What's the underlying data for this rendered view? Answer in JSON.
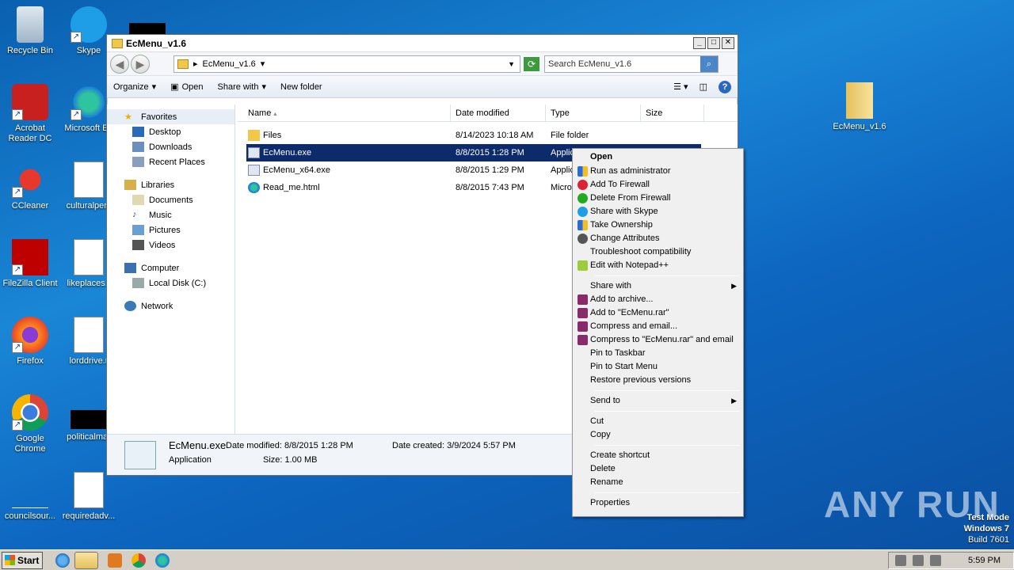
{
  "desktop": {
    "icons_left": [
      "Recycle Bin",
      "Acrobat Reader DC",
      "CCleaner",
      "FileZilla Client",
      "Firefox",
      "Google Chrome",
      "councilsour..."
    ],
    "icons_right": [
      "Skype",
      "Microsoft Ed",
      "culturalpers",
      "likeplaces.r",
      "lorddrive.r",
      "politicalmar",
      "requiredadv..."
    ],
    "folder_icon": "EcMenu_v1.6"
  },
  "window": {
    "title": "EcMenu_v1.6",
    "address": "EcMenu_v1.6",
    "search_placeholder": "Search EcMenu_v1.6",
    "toolbar": {
      "organize": "Organize",
      "open": "Open",
      "share_with": "Share with",
      "new_folder": "New folder"
    },
    "nav": {
      "favorites": "Favorites",
      "desktop": "Desktop",
      "downloads": "Downloads",
      "recent": "Recent Places",
      "libraries": "Libraries",
      "documents": "Documents",
      "music": "Music",
      "pictures": "Pictures",
      "videos": "Videos",
      "computer": "Computer",
      "local_disk": "Local Disk (C:)",
      "network": "Network"
    },
    "columns": {
      "name": "Name",
      "date": "Date modified",
      "type": "Type",
      "size": "Size"
    },
    "files": [
      {
        "name": "Files",
        "date": "8/14/2023 10:18 AM",
        "type": "File folder"
      },
      {
        "name": "EcMenu.exe",
        "date": "8/8/2015 1:28 PM",
        "type": "Applic"
      },
      {
        "name": "EcMenu_x64.exe",
        "date": "8/8/2015 1:29 PM",
        "type": "Applic"
      },
      {
        "name": "Read_me.html",
        "date": "8/8/2015 7:43 PM",
        "type": "Micros"
      }
    ],
    "details": {
      "filename": "EcMenu.exe",
      "type": "Application",
      "modified_label": "Date modified: 8/8/2015 1:28 PM",
      "created_label": "Date created: 3/9/2024 5:57 PM",
      "size_label": "Size: 1.00 MB"
    }
  },
  "context_menu": {
    "group1": [
      "Open",
      "Run as administrator",
      "Add To Firewall",
      "Delete From Firewall",
      "Share with Skype",
      "Take Ownership",
      "Change Attributes",
      "Troubleshoot compatibility",
      "Edit with Notepad++"
    ],
    "group2": [
      "Share with",
      "Add to archive...",
      "Add to \"EcMenu.rar\"",
      "Compress and email...",
      "Compress to \"EcMenu.rar\" and email",
      "Pin to Taskbar",
      "Pin to Start Menu",
      "Restore previous versions"
    ],
    "group3": [
      "Send to"
    ],
    "group4": [
      "Cut",
      "Copy"
    ],
    "group5": [
      "Create shortcut",
      "Delete",
      "Rename"
    ],
    "group6": [
      "Properties"
    ]
  },
  "watermark": "ANY RUN",
  "os_info": {
    "line1": "Test Mode",
    "line2": "Windows 7",
    "line3": "Build 7601"
  },
  "taskbar": {
    "start": "Start",
    "clock": "5:59 PM"
  }
}
